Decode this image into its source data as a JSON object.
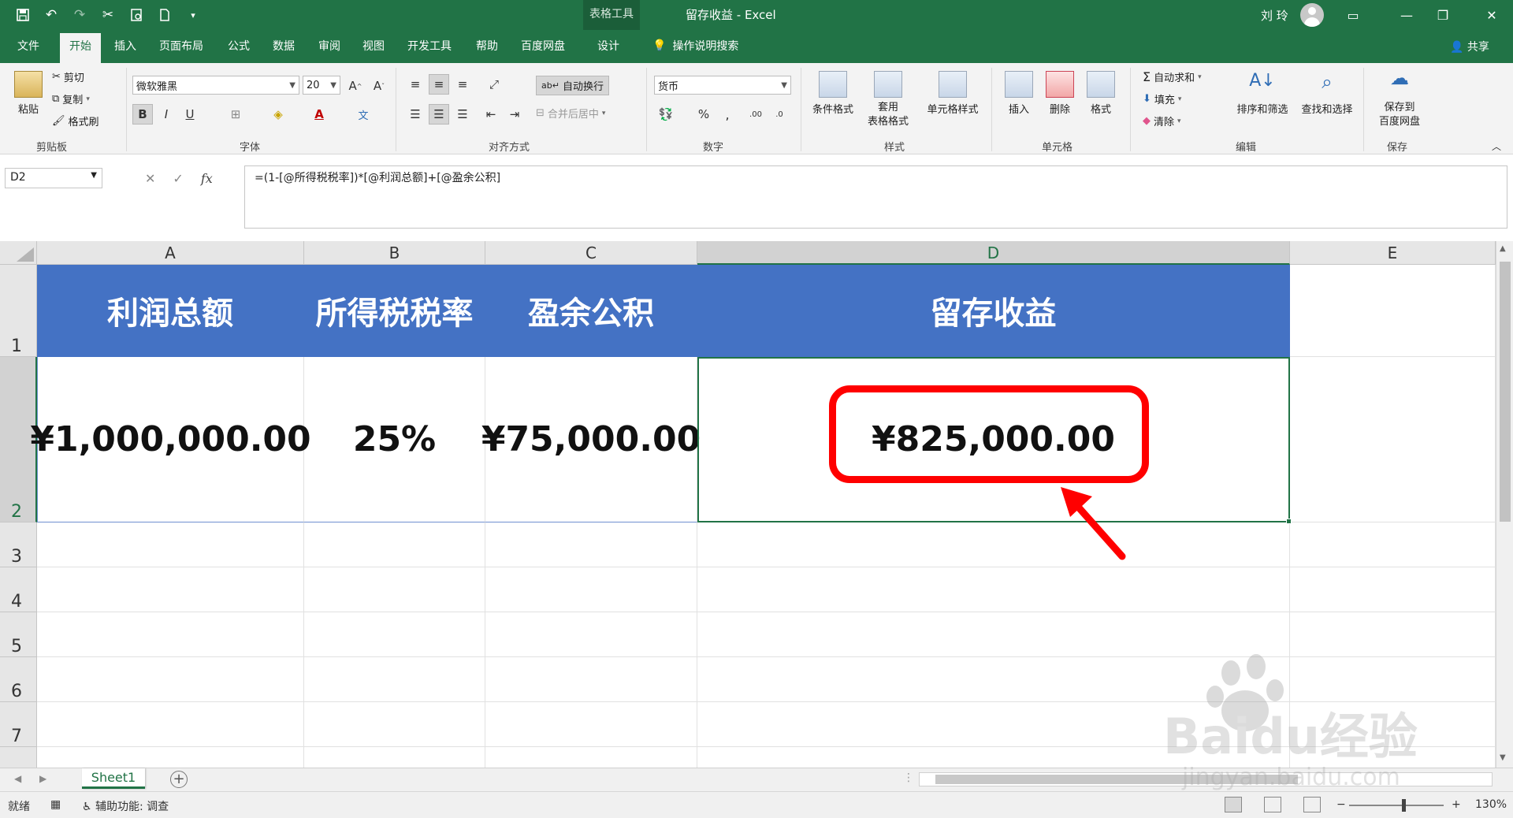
{
  "titlebar": {
    "context_tool": "表格工具",
    "window_title": "留存收益  -  Excel",
    "user_name": "刘 玲"
  },
  "tabs": [
    "文件",
    "开始",
    "插入",
    "页面布局",
    "公式",
    "数据",
    "审阅",
    "视图",
    "开发工具",
    "帮助",
    "百度网盘",
    "设计"
  ],
  "tell_me": "操作说明搜索",
  "share": "共享",
  "ribbon": {
    "clipboard": {
      "label": "剪贴板",
      "paste": "粘贴",
      "cut": "剪切",
      "copy": "复制",
      "format_painter": "格式刷"
    },
    "font": {
      "label": "字体",
      "font_name": "微软雅黑",
      "font_size": "20"
    },
    "alignment": {
      "label": "对齐方式",
      "wrap_text": "自动换行",
      "merge_center": "合并后居中"
    },
    "number": {
      "label": "数字",
      "format": "货币"
    },
    "styles": {
      "label": "样式",
      "conditional": "条件格式",
      "table_format": "套用\n表格格式",
      "cell_styles": "单元格样式"
    },
    "cells": {
      "label": "单元格",
      "insert": "插入",
      "delete": "删除",
      "format": "格式"
    },
    "editing": {
      "label": "编辑",
      "autosum": "自动求和",
      "fill": "填充",
      "clear": "清除",
      "sort_filter": "排序和筛选",
      "find_select": "查找和选择"
    },
    "save": {
      "label": "保存",
      "save_baidu": "保存到\n百度网盘"
    }
  },
  "formula_bar": {
    "name_box": "D2",
    "fx": "fx",
    "formula": "=(1-[@所得税税率])*[@利润总额]+[@盈余公积]"
  },
  "grid": {
    "columns": [
      "A",
      "B",
      "C",
      "D",
      "E"
    ],
    "rows": [
      "1",
      "2",
      "3",
      "4",
      "5",
      "6",
      "7"
    ],
    "headers": [
      "利润总额",
      "所得税税率",
      "盈余公积",
      "留存收益"
    ],
    "values": [
      "¥1,000,000.00",
      "25%",
      "¥75,000.00",
      "¥825,000.00"
    ]
  },
  "sheets": {
    "active": "Sheet1"
  },
  "status": {
    "ready": "就绪",
    "accessibility": "辅助功能: 调查",
    "zoom": "130%"
  },
  "watermark": {
    "brand": "Baidu经验",
    "url": "jingyan.baidu.com"
  },
  "colors": {
    "excel_green": "#217346",
    "header_blue": "#4472c4",
    "highlight_red": "#ff0000"
  }
}
